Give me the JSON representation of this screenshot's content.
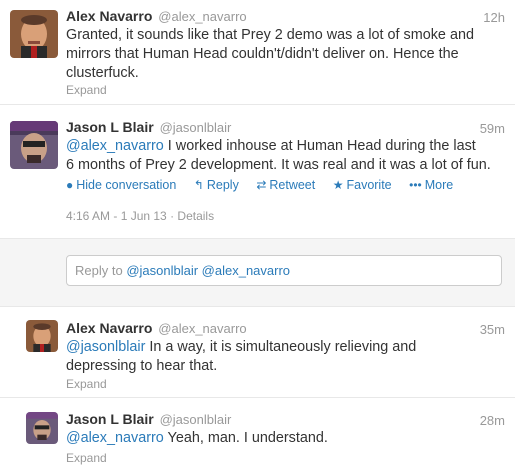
{
  "tweets": [
    {
      "fullname": "Alex Navarro",
      "username": "@alex_navarro",
      "time": "12h",
      "text_line1": "Granted, it sounds like that Prey 2 demo was a lot of smoke and",
      "text_line2": "mirrors that Human Head couldn't/didn't deliver on. Hence the",
      "text_line3": "clusterfuck.",
      "expand": "Expand"
    },
    {
      "fullname": "Jason L Blair",
      "username": "@jasonlblair",
      "time": "59m",
      "mention": "@alex_navarro",
      "text_line1_rest": " I worked inhouse at Human Head during the last",
      "text_line2": "6 months of Prey 2 development. It was real and it was a lot of fun.",
      "actions": {
        "hide": "Hide conversation",
        "reply": "Reply",
        "retweet": "Retweet",
        "favorite": "Favorite",
        "more": "More"
      },
      "timestamp": "4:16 AM - 1 Jun 13",
      "details": "Details"
    },
    {
      "fullname": "Alex Navarro",
      "username": "@alex_navarro",
      "time": "35m",
      "mention": "@jasonlblair",
      "text_line1_rest": " In a way, it is simultaneously relieving and",
      "text_line2": "depressing to hear that.",
      "expand": "Expand"
    },
    {
      "fullname": "Jason L Blair",
      "username": "@jasonlblair",
      "time": "28m",
      "mention": "@alex_navarro",
      "text_line1_rest": " Yeah, man. I understand.",
      "expand": "Expand"
    }
  ],
  "reply_box": {
    "prefix": "Reply to ",
    "mention1": "@jasonlblair",
    "mention2": "@alex_navarro"
  },
  "colors": {
    "link": "#2b7bb9",
    "muted": "#999999",
    "text": "#333333"
  }
}
